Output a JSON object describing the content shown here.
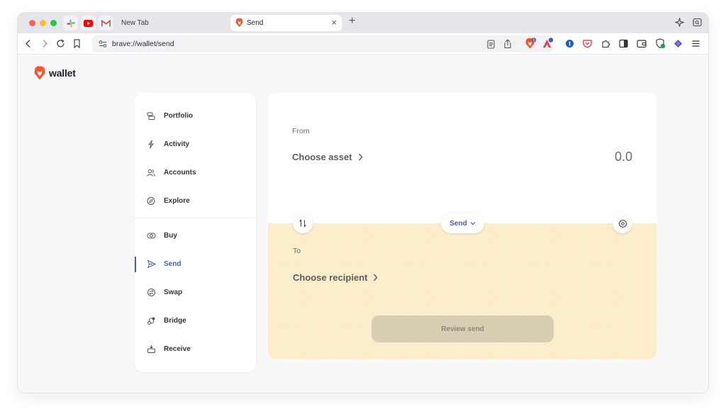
{
  "browser": {
    "pinned_tabs": [
      "slack-icon",
      "youtube-icon",
      "gmail-icon"
    ],
    "new_tab_label": "New Tab",
    "active_tab": {
      "title": "Send"
    },
    "address": "brave://wallet/send",
    "shields_badge": "0"
  },
  "wallet": {
    "brand": "wallet",
    "nav": {
      "items": [
        {
          "label": "Portfolio",
          "icon": "portfolio-icon"
        },
        {
          "label": "Activity",
          "icon": "activity-icon"
        },
        {
          "label": "Accounts",
          "icon": "accounts-icon"
        },
        {
          "label": "Explore",
          "icon": "explore-icon"
        },
        {
          "label": "Buy",
          "icon": "buy-icon"
        },
        {
          "label": "Send",
          "icon": "send-icon",
          "active": true
        },
        {
          "label": "Swap",
          "icon": "swap-icon"
        },
        {
          "label": "Bridge",
          "icon": "bridge-icon"
        },
        {
          "label": "Receive",
          "icon": "receive-icon"
        }
      ]
    },
    "send": {
      "from_label": "From",
      "choose_asset": "Choose asset",
      "amount": "0.0",
      "mode": "Send",
      "to_label": "To",
      "choose_recipient": "Choose recipient",
      "review_button": "Review send"
    }
  },
  "colors": {
    "accent": "#4a5bbd",
    "to_section_bg": "#fdeecb",
    "review_disabled": "#d6cdb2",
    "brave_orange": "#fb542b"
  }
}
